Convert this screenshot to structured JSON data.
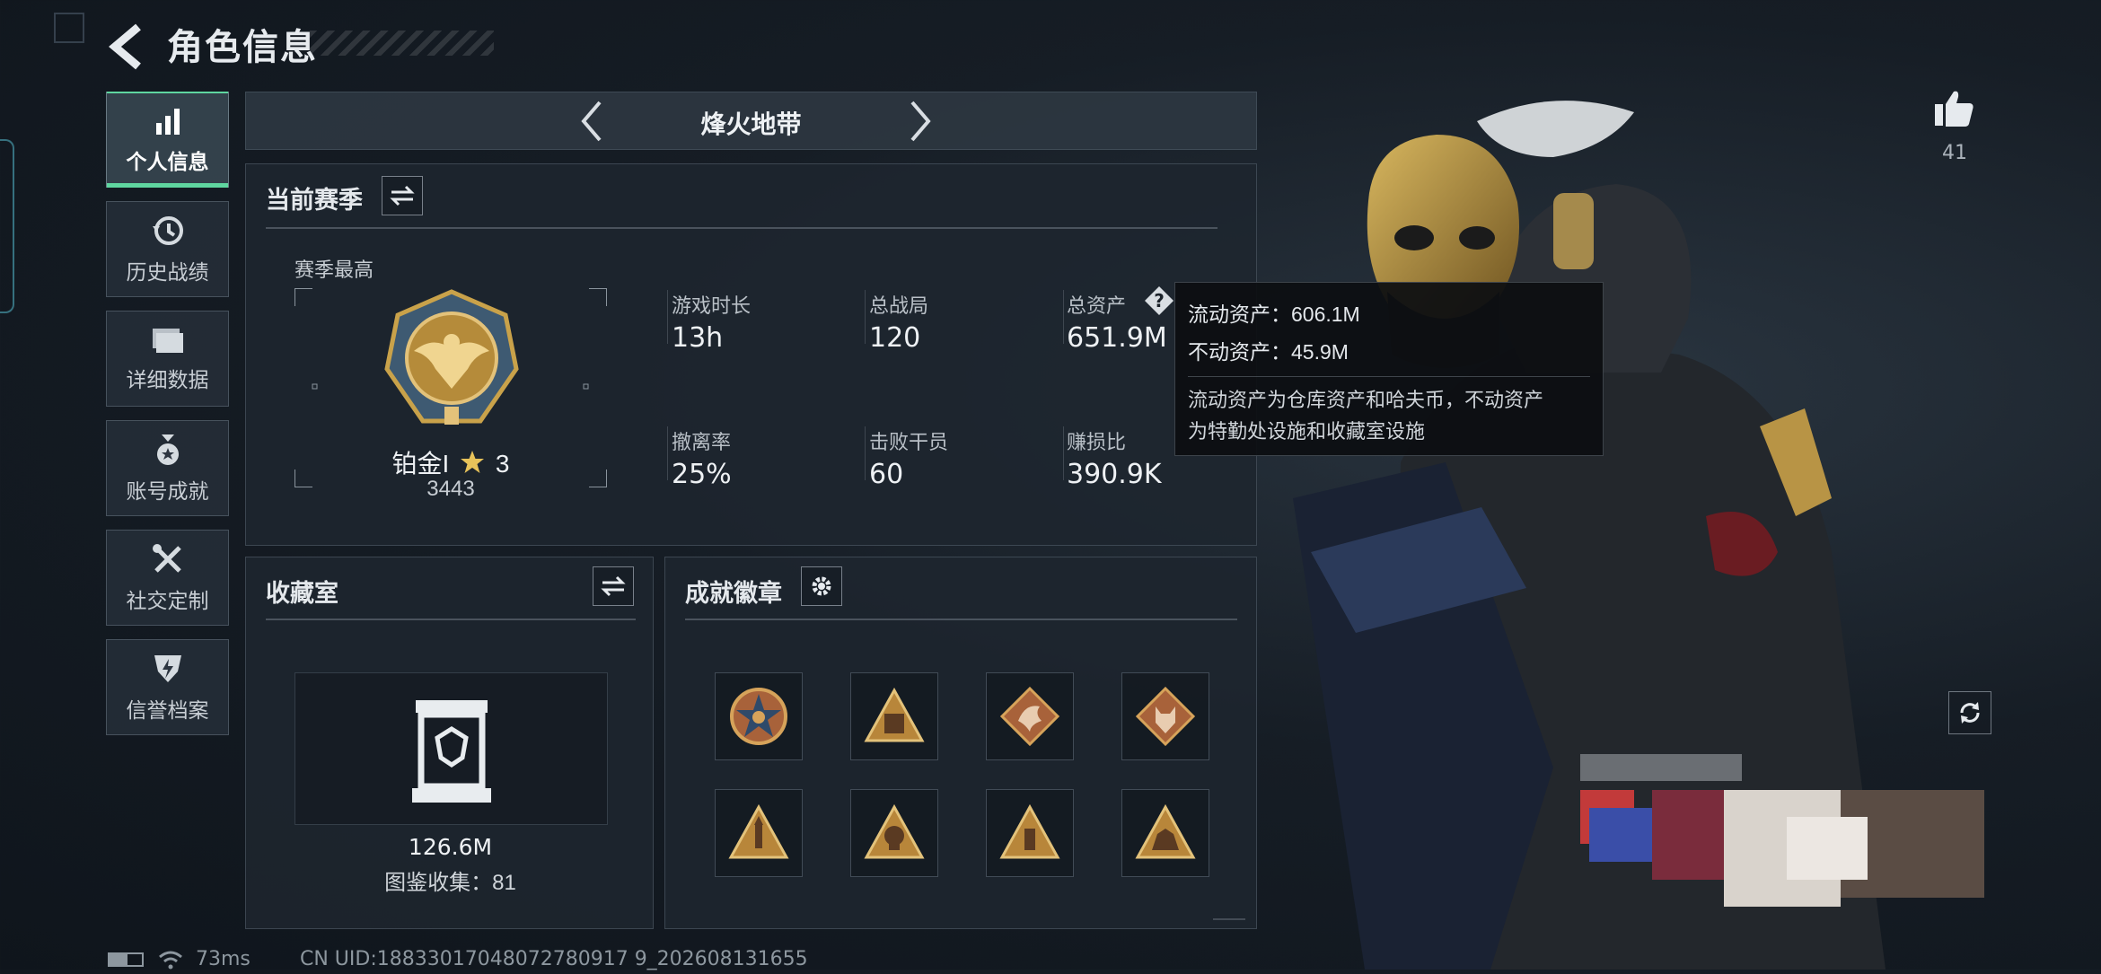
{
  "header": {
    "title": "角色信息"
  },
  "sidebar": {
    "items": [
      {
        "label": "个人信息",
        "active": true
      },
      {
        "label": "历史战绩"
      },
      {
        "label": "详细数据"
      },
      {
        "label": "账号成就"
      },
      {
        "label": "社交定制"
      },
      {
        "label": "信誉档案"
      }
    ]
  },
  "mode_bar": {
    "name": "烽火地带"
  },
  "season": {
    "title": "当前赛季",
    "highest_label": "赛季最高",
    "rank_name": "铂金I",
    "rank_stars": "3",
    "rank_score": "3443",
    "stats": [
      {
        "label": "游戏时长",
        "value": "13h"
      },
      {
        "label": "总战局",
        "value": "120"
      },
      {
        "label": "总资产",
        "value": "651.9M"
      },
      {
        "label": "撤离率",
        "value": "25%"
      },
      {
        "label": "击败干员",
        "value": "60"
      },
      {
        "label": "赚损比",
        "value": "390.9K"
      }
    ]
  },
  "tooltip": {
    "liquid": "流动资产：606.1M",
    "fixed": "不动资产：45.9M",
    "desc_line1": "流动资产为仓库资产和哈夫币，不动资产",
    "desc_line2": "为特勤处设施和收藏室设施"
  },
  "collection": {
    "title": "收藏室",
    "value": "126.6M",
    "count_text": "图鉴收集：81"
  },
  "achievements": {
    "title": "成就徽章",
    "badges": [
      "star-medal",
      "triangle-badge-gold",
      "dragon-badge",
      "wolf-badge",
      "rocket-badge",
      "skull-badge",
      "ammo-badge",
      "beast-badge"
    ]
  },
  "likes": {
    "count": "41"
  },
  "status_bar": {
    "ping": "73ms",
    "uid": "CN UID:18833017048072780917 9_202608131655"
  },
  "colors": {
    "accent": "#5fd6a0",
    "gold": "#c9a24a",
    "badge_bronze": "#a8623a"
  }
}
